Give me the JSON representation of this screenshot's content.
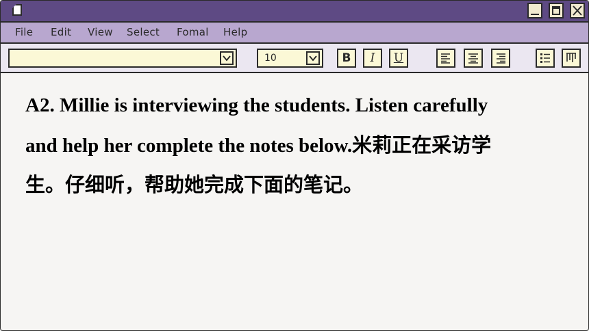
{
  "window": {
    "controls": [
      "minimize",
      "maximize",
      "close"
    ]
  },
  "menu": {
    "items": [
      "File",
      "Edit",
      "View",
      "Select",
      "Fomal",
      "Help"
    ]
  },
  "toolbar": {
    "font_name": "",
    "font_size": "10",
    "bold_label": "B",
    "italic_label": "I",
    "underline_label": "U"
  },
  "document": {
    "line1": "A2. Millie is interviewing the students. Listen carefully",
    "line2": "and help her complete the notes below.米莉正在采访学",
    "line3": "生。仔细听，帮助她完成下面的笔记。"
  },
  "colors": {
    "titlebar": "#5e4a84",
    "menubar": "#b8a7cf",
    "toolbar": "#ebe7f1",
    "field": "#fbf8d6",
    "page": "#f6f5f3"
  }
}
